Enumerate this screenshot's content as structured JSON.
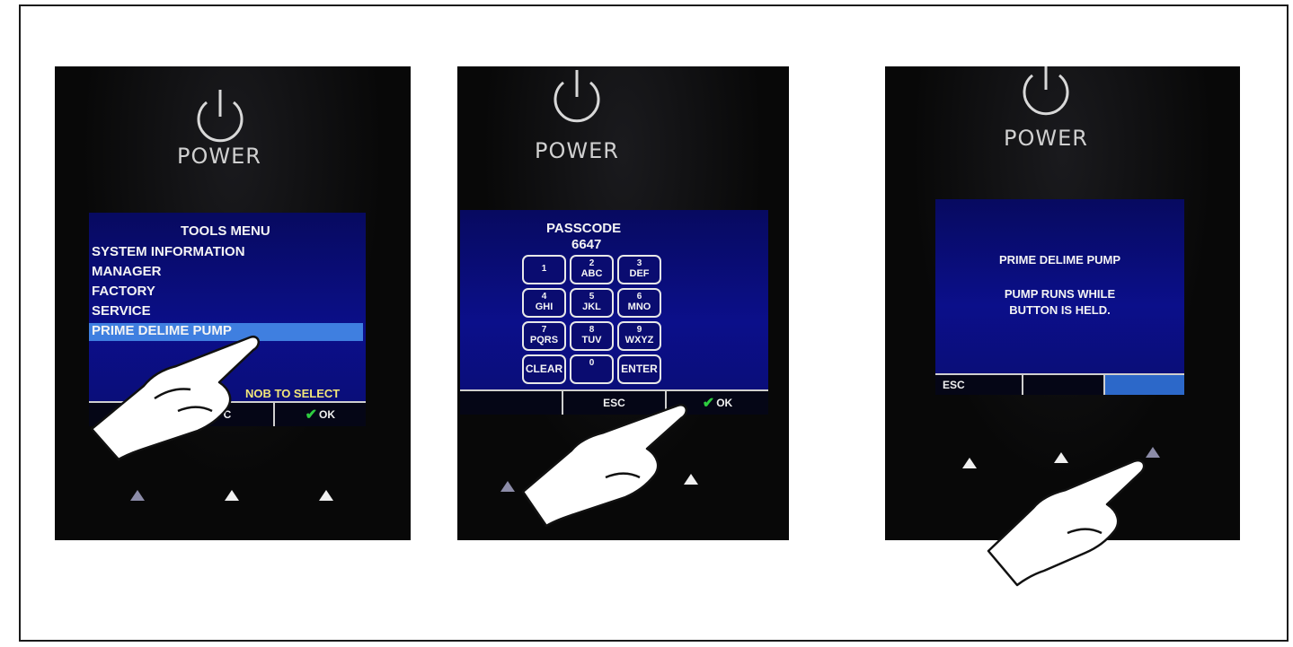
{
  "panel1": {
    "power_label": "POWER",
    "menu_title": "TOOLS MENU",
    "menu_items": [
      "SYSTEM INFORMATION",
      "MANAGER",
      "FACTORY",
      "SERVICE",
      "PRIME DELIME PUMP"
    ],
    "selected_index": 4,
    "hint": "NOB TO SELECT",
    "softkeys": [
      "",
      "C",
      "OK"
    ]
  },
  "panel2": {
    "power_label": "POWER",
    "title": "PASSCODE",
    "code": "6647",
    "keys": [
      {
        "digit": "1",
        "letters": ""
      },
      {
        "digit": "2",
        "letters": "ABC"
      },
      {
        "digit": "3",
        "letters": "DEF"
      },
      {
        "digit": "4",
        "letters": "GHI"
      },
      {
        "digit": "5",
        "letters": "JKL"
      },
      {
        "digit": "6",
        "letters": "MNO"
      },
      {
        "digit": "7",
        "letters": "PQRS"
      },
      {
        "digit": "8",
        "letters": "TUV"
      },
      {
        "digit": "9",
        "letters": "WXYZ"
      },
      {
        "digit": "",
        "letters": "CLEAR"
      },
      {
        "digit": "0",
        "letters": ""
      },
      {
        "digit": "",
        "letters": "ENTER"
      }
    ],
    "softkeys": [
      "",
      "ESC",
      "OK"
    ]
  },
  "panel3": {
    "power_label": "POWER",
    "title": "PRIME DELIME PUMP",
    "line1": "PUMP RUNS WHILE",
    "line2": "BUTTON IS HELD.",
    "softkeys": [
      "ESC",
      "",
      ""
    ]
  },
  "colors": {
    "screen_blue": "#0b0f8a",
    "selection_blue": "#3f7fe0",
    "check_green": "#2ecc40",
    "hint_yellow": "#f2e67a"
  }
}
